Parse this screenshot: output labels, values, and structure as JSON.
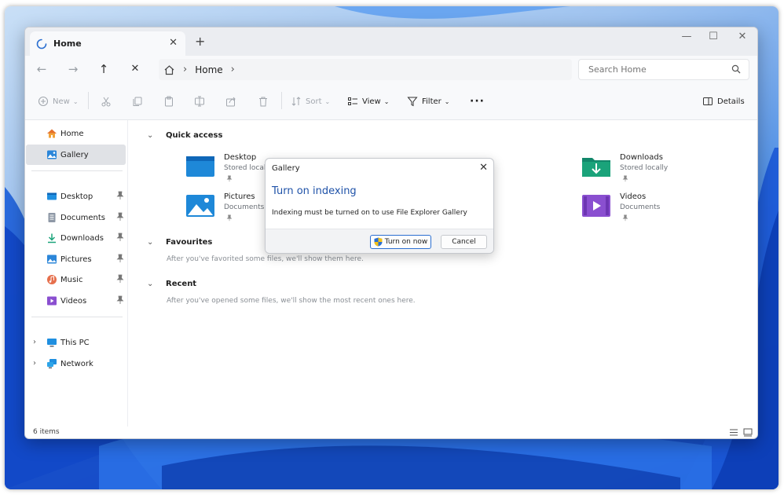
{
  "colors": {
    "accent": "#1f52a8",
    "folder_blue": "#1e88d8",
    "folder_green": "#1aa37a",
    "folder_purple": "#8a4fd0"
  },
  "tab": {
    "label": "Home",
    "icon": "home-spinner-icon"
  },
  "address": {
    "crumb": "Home"
  },
  "search": {
    "placeholder": "Search Home"
  },
  "toolbar": {
    "new_label": "New",
    "sort_label": "Sort",
    "view_label": "View",
    "filter_label": "Filter",
    "details_label": "Details"
  },
  "sidebar": {
    "items": [
      {
        "label": "Home",
        "icon": "home-icon"
      },
      {
        "label": "Gallery",
        "icon": "gallery-icon",
        "selected": true
      },
      {
        "label": "Desktop",
        "icon": "desktop-icon",
        "pinned": true
      },
      {
        "label": "Documents",
        "icon": "documents-icon",
        "pinned": true
      },
      {
        "label": "Downloads",
        "icon": "downloads-icon",
        "pinned": true
      },
      {
        "label": "Pictures",
        "icon": "pictures-icon",
        "pinned": true
      },
      {
        "label": "Music",
        "icon": "music-icon",
        "pinned": true
      },
      {
        "label": "Videos",
        "icon": "videos-icon",
        "pinned": true
      },
      {
        "label": "This PC",
        "icon": "this-pc-icon"
      },
      {
        "label": "Network",
        "icon": "network-icon"
      }
    ]
  },
  "content": {
    "quick_access_title": "Quick access",
    "quick_access_items": [
      {
        "name": "Desktop",
        "sub": "Stored local"
      },
      {
        "name": "Downloads",
        "sub": "Stored locally"
      },
      {
        "name": "Pictures",
        "sub": "Documents"
      },
      {
        "name": "Videos",
        "sub": "Documents"
      }
    ],
    "favourites_title": "Favourites",
    "favourites_hint": "After you've favorited some files, we'll show them here.",
    "recent_title": "Recent",
    "recent_hint": "After you've opened some files, we'll show the most recent ones here."
  },
  "status": {
    "count": "6 items"
  },
  "dialog": {
    "title": "Gallery",
    "heading": "Turn on indexing",
    "message": "Indexing must be turned on to use File Explorer Gallery",
    "primary_label": "Turn on now",
    "cancel_label": "Cancel"
  }
}
